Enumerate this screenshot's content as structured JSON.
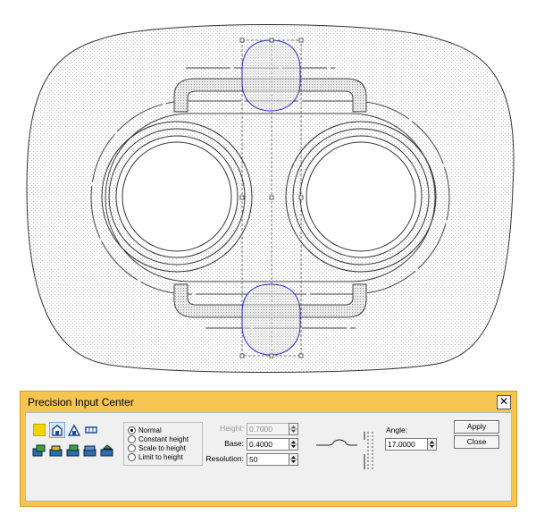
{
  "dialog": {
    "title": "Precision Input Center",
    "close_glyph": "✕",
    "toolbar": {
      "row1": [
        "color-swatch-icon",
        "house-outline-icon",
        "house-peak-icon",
        "flat-bar-icon"
      ],
      "row2": [
        "tool-blocks-icon-1",
        "tool-blocks-icon-2",
        "tool-blocks-icon-3",
        "tool-blocks-icon-4",
        "tool-blocks-icon-5"
      ],
      "swatch_color": "#f2d400",
      "active_color": "#1f4e9a"
    },
    "modes": {
      "options": [
        "Normal",
        "Constant height",
        "Scale to height",
        "Limit to height"
      ],
      "selected": "Normal"
    },
    "fields": {
      "height": {
        "label": "Height:",
        "value": "0.7000"
      },
      "base": {
        "label": "Base:",
        "value": "0.4000"
      },
      "resolution": {
        "label": "Resolution:",
        "value": "50"
      },
      "angle": {
        "label": "Angle:",
        "value": "17.0000"
      }
    },
    "buttons": {
      "apply": "Apply",
      "close": "Close"
    }
  },
  "canvas": {
    "background": "#ffffff",
    "outline_color": "#333333",
    "selection_color": "#2b2bd6"
  }
}
